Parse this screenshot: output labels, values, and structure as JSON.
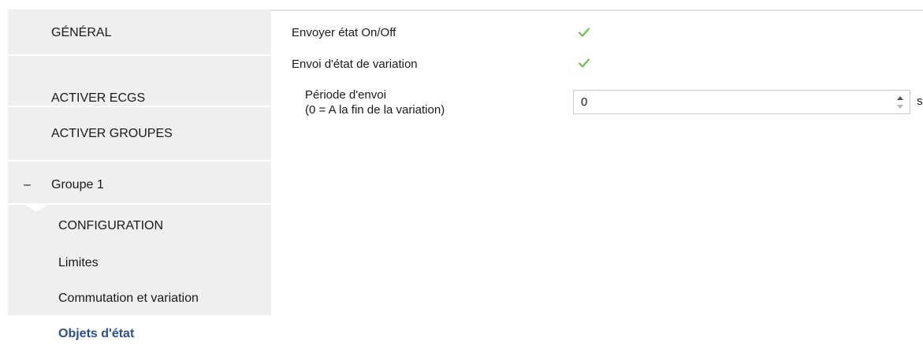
{
  "sidebar": {
    "items": [
      {
        "label": "GÉNÉRAL"
      },
      {
        "label": "ACTIVER ECGS"
      },
      {
        "label": "ACTIVER GROUPES"
      }
    ],
    "group": {
      "toggle": "–",
      "label": "Groupe 1"
    },
    "sub_items": [
      {
        "label": "CONFIGURATION"
      },
      {
        "label": "Limites"
      },
      {
        "label": "Commutation et variation"
      },
      {
        "label": "Objets d'état",
        "selected": true
      }
    ]
  },
  "main": {
    "send_onoff": {
      "label": "Envoyer état On/Off",
      "checked": true
    },
    "send_dimming": {
      "label": "Envoi d'état de variation",
      "checked": true
    },
    "period": {
      "label_line1": "Période d'envoi",
      "label_line2": "(0 = A la fin de la variation)",
      "value": "0",
      "unit": "s"
    }
  },
  "colors": {
    "sidebar_bg": "#efefef",
    "selected_text": "#2a4f8b",
    "check_green": "#6cc04a"
  },
  "icons": [
    "checkmark-icon",
    "spinner-up-icon",
    "spinner-down-icon"
  ]
}
